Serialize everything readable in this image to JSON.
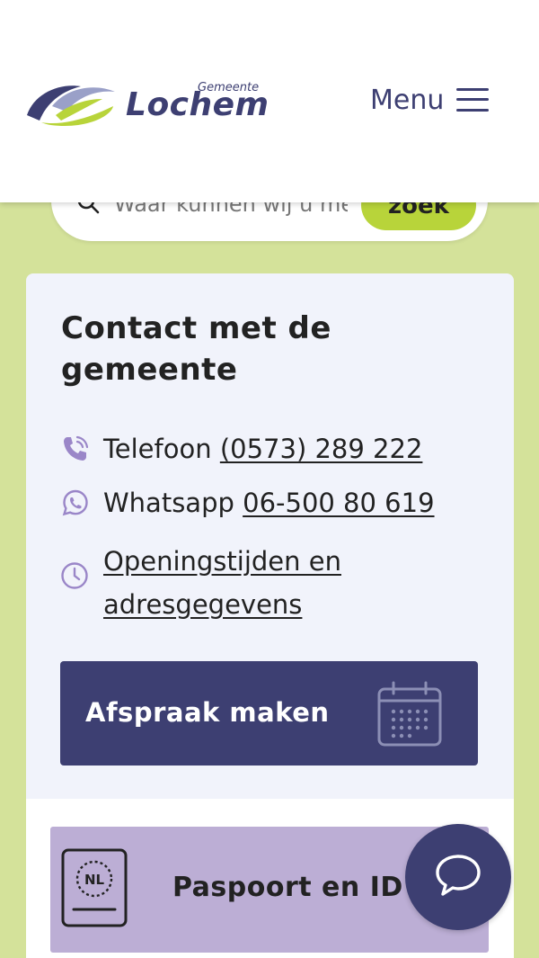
{
  "header": {
    "logo_small": "Gemeente",
    "logo_name": "Lochem",
    "menu_label": "Menu"
  },
  "search": {
    "placeholder": "Waar kunnen wij u mee helpen?",
    "button_label": "zoek"
  },
  "contact": {
    "title": "Contact met de gemeente",
    "phone_label": "Telefoon",
    "phone_number": "(0573) 289 222",
    "whatsapp_label": "Whatsapp",
    "whatsapp_number": "06-500 80 619",
    "hours_link": "Openingstijden en adresgegevens",
    "appointment_label": "Afspraak maken"
  },
  "tiles": {
    "passport_label": "Paspoort en ID",
    "passport_badge": "NL"
  },
  "colors": {
    "brand_dark": "#3d3f72",
    "brand_green": "#b8d43a",
    "page_bg": "#d4e29a",
    "icon_purple": "#9a86c8",
    "tile_purple": "#bcaed5"
  },
  "icons": {
    "search": "search-icon",
    "menu": "hamburger-icon",
    "phone": "phone-icon",
    "whatsapp": "whatsapp-icon",
    "clock": "clock-icon",
    "calendar": "calendar-icon",
    "passport": "passport-icon",
    "chat": "chat-icon"
  }
}
